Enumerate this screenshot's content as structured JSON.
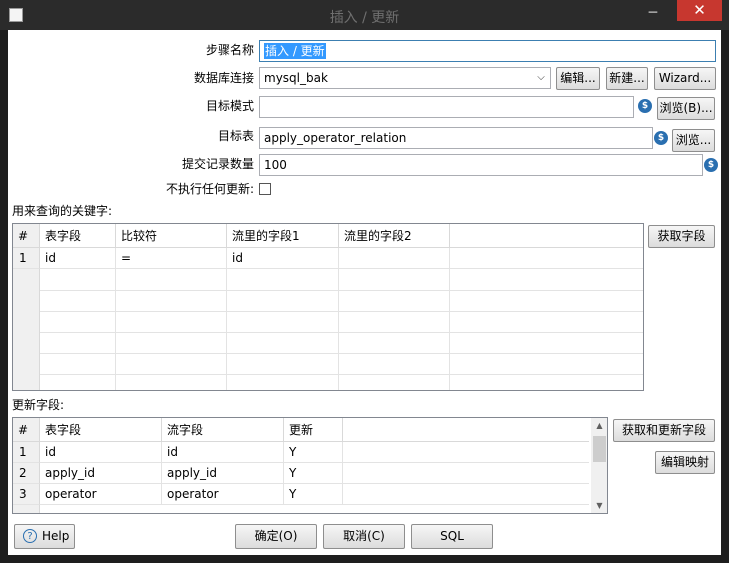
{
  "window": {
    "title": "插入 / 更新",
    "minimize_glyph": "─",
    "close_glyph": "✕"
  },
  "form": {
    "step_name_label": "步骤名称",
    "step_name_value": "插入 / 更新",
    "db_conn_label": "数据库连接",
    "db_conn_value": "mysql_bak",
    "edit_btn": "编辑...",
    "new_btn": "新建...",
    "wizard_btn": "Wizard...",
    "schema_label": "目标模式",
    "schema_value": "",
    "browse_schema_btn": "浏览(B)...",
    "table_label": "目标表",
    "table_value": "apply_operator_relation",
    "browse_table_btn": "浏览...",
    "commit_label": "提交记录数量",
    "commit_value": "100",
    "no_update_label": "不执行任何更新:",
    "var_icon_glyph": "$",
    "dropdown_glyph": "⌵"
  },
  "keys": {
    "section_label": "用来查询的关键字:",
    "get_fields_btn": "获取字段",
    "headers": [
      "#",
      "表字段",
      "比较符",
      "流里的字段1",
      "流里的字段2"
    ],
    "rows": [
      [
        "1",
        "id",
        "=",
        "id",
        ""
      ]
    ]
  },
  "updates": {
    "section_label": "更新字段:",
    "get_update_fields_btn": "获取和更新字段",
    "edit_mapping_btn": "编辑映射",
    "headers": [
      "#",
      "表字段",
      "流字段",
      "更新"
    ],
    "rows": [
      [
        "1",
        "id",
        "id",
        "Y"
      ],
      [
        "2",
        "apply_id",
        "apply_id",
        "Y"
      ],
      [
        "3",
        "operator",
        "operator",
        "Y"
      ]
    ],
    "scroll_up": "▲",
    "scroll_down": "▼"
  },
  "footer": {
    "help_btn": "Help",
    "help_glyph": "?",
    "ok_btn": "确定(O)",
    "cancel_btn": "取消(C)",
    "sql_btn": "SQL"
  }
}
